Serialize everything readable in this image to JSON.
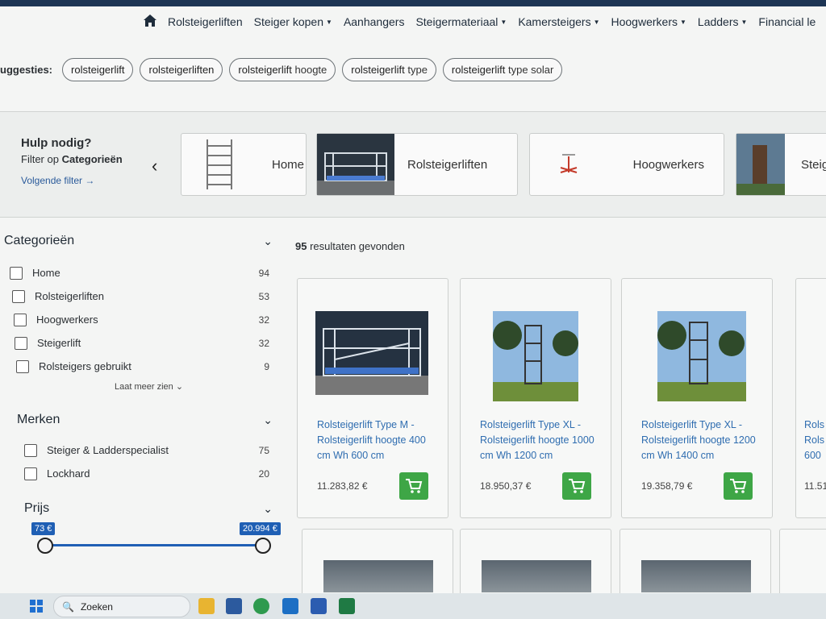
{
  "nav": {
    "home_icon": "home-icon",
    "items": [
      {
        "label": "Rolsteigerliften",
        "dropdown": false
      },
      {
        "label": "Steiger kopen",
        "dropdown": true
      },
      {
        "label": "Aanhangers",
        "dropdown": false
      },
      {
        "label": "Steigermateriaal",
        "dropdown": true
      },
      {
        "label": "Kamersteigers",
        "dropdown": true
      },
      {
        "label": "Hoogwerkers",
        "dropdown": true
      },
      {
        "label": "Ladders",
        "dropdown": true
      },
      {
        "label": "Financial le",
        "dropdown": false
      }
    ]
  },
  "suggestions": {
    "label": "uggesties:",
    "chips": [
      {
        "main": "rolsteigerlift",
        "rest": ""
      },
      {
        "main": "rolsteigerliften",
        "rest": ""
      },
      {
        "main": "rolsteigerlift",
        "rest": " hoogte"
      },
      {
        "main": "rolsteigerlift",
        "rest": " type"
      },
      {
        "main": "rolsteigerlift",
        "rest": " type solar"
      }
    ]
  },
  "category_bar": {
    "help_title": "Hulp nodig?",
    "help_sub_prefix": "Filter op ",
    "help_sub_bold": "Categorieën",
    "next_filter": "Volgende filter →",
    "cards": [
      {
        "name": "Home"
      },
      {
        "name": "Rolsteigerliften"
      },
      {
        "name": "Hoogwerkers"
      },
      {
        "name": "Steig"
      }
    ]
  },
  "filters": {
    "categories": {
      "title": "Categorieën",
      "items": [
        {
          "label": "Home",
          "count": "94"
        },
        {
          "label": "Rolsteigerliften",
          "count": "53"
        },
        {
          "label": "Hoogwerkers",
          "count": "32"
        },
        {
          "label": "Steigerlift",
          "count": "32"
        },
        {
          "label": "Rolsteigers gebruikt",
          "count": "9"
        }
      ],
      "more": "Laat meer zien"
    },
    "brands": {
      "title": "Merken",
      "items": [
        {
          "label": "Steiger & Ladderspecialist",
          "count": "75"
        },
        {
          "label": "Lockhard",
          "count": "20"
        }
      ]
    },
    "price": {
      "title": "Prijs",
      "min_label": "73 €",
      "max_label": "20.994 €"
    }
  },
  "results": {
    "count": "95",
    "text": " resultaten gevonden"
  },
  "products": [
    {
      "title": "Rolsteigerlift Type M - Rolsteigerlift hoogte 400 cm Wh 600 cm",
      "price": "11.283,82 €"
    },
    {
      "title": "Rolsteigerlift Type XL - Rolsteigerlift hoogte 1000 cm Wh 1200 cm",
      "price": "18.950,37 €"
    },
    {
      "title": "Rolsteigerlift Type XL - Rolsteigerlift hoogte 1200 cm Wh 1400 cm",
      "price": "19.358,79 €"
    },
    {
      "title": "Rols Rols 600",
      "price": "11.51"
    }
  ],
  "taskbar": {
    "search_placeholder": "Zoeken"
  },
  "colors": {
    "link": "#2f6db0",
    "cart": "#3ea646",
    "slider": "#1f5fb4"
  }
}
